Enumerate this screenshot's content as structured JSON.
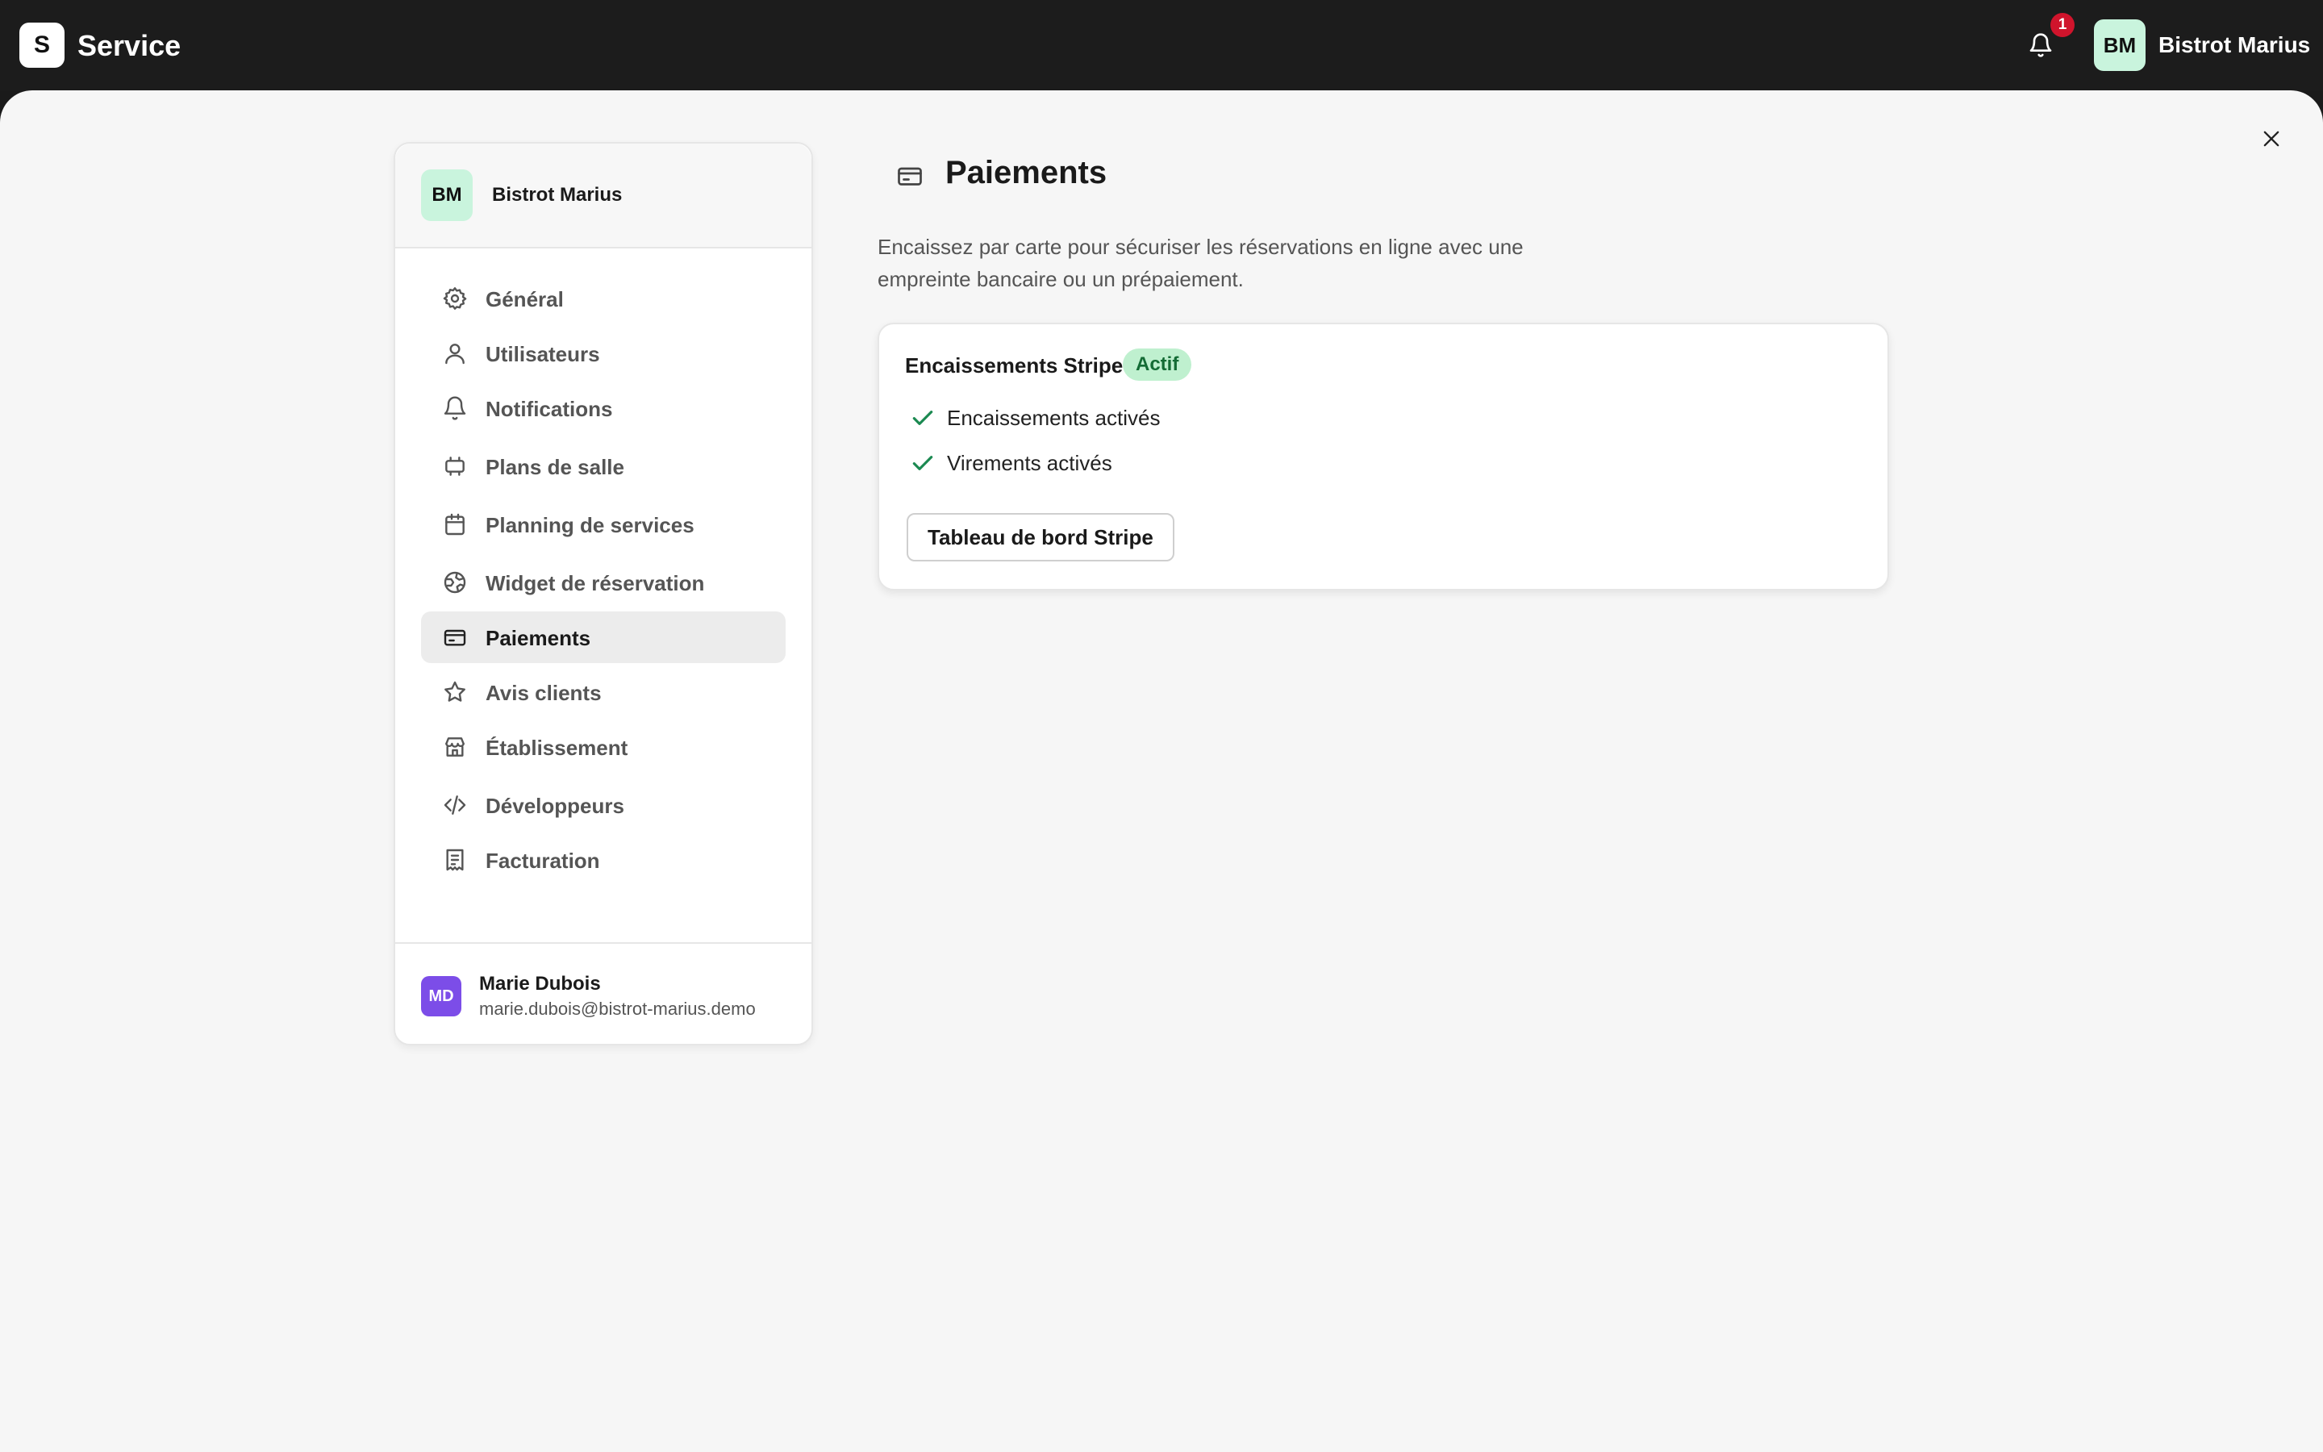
{
  "topbar": {
    "logo_letter": "S",
    "app_name": "Service",
    "notification_count": "1",
    "avatar_initials": "BM",
    "org_name": "Bistrot Marius"
  },
  "sidebar": {
    "org_initials": "BM",
    "org_name": "Bistrot Marius",
    "items": [
      {
        "label": "Général",
        "icon": "gear-icon"
      },
      {
        "label": "Utilisateurs",
        "icon": "user-icon"
      },
      {
        "label": "Notifications",
        "icon": "bell-icon"
      },
      {
        "label": "Plans de salle",
        "icon": "floor-plan-icon"
      },
      {
        "label": "Planning de services",
        "icon": "calendar-icon"
      },
      {
        "label": "Widget de réservation",
        "icon": "globe-icon"
      },
      {
        "label": "Paiements",
        "icon": "credit-card-icon",
        "active": true
      },
      {
        "label": "Avis clients",
        "icon": "star-icon"
      },
      {
        "label": "Établissement",
        "icon": "store-icon"
      },
      {
        "label": "Développeurs",
        "icon": "code-icon"
      },
      {
        "label": "Facturation",
        "icon": "receipt-icon"
      }
    ],
    "user": {
      "initials": "MD",
      "name": "Marie Dubois",
      "email": "marie.dubois@bistrot-marius.demo"
    }
  },
  "main": {
    "title": "Paiements",
    "description": "Encaissez par carte pour sécuriser les réservations en ligne avec une empreinte bancaire ou un prépaiement.",
    "card": {
      "title": "Encaissements Stripe",
      "badge": "Actif",
      "checks": [
        "Encaissements activés",
        "Virements activés"
      ],
      "button_label": "Tableau de bord Stripe"
    }
  },
  "colors": {
    "topbar_bg": "#1c1c1c",
    "sheet_bg": "#f6f6f6",
    "avatar_green": "#c9f4dd",
    "badge_bg": "#bff0cf",
    "badge_text": "#146c35",
    "user_avatar": "#7c4de8",
    "notification_red": "#d0142c"
  }
}
